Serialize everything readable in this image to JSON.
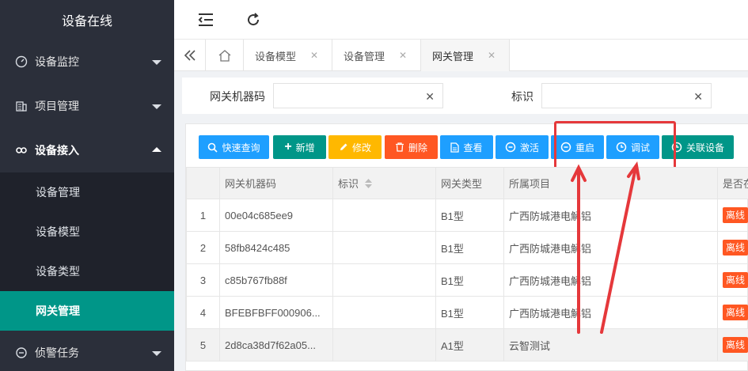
{
  "app": {
    "title": "设备在线"
  },
  "sidebar": {
    "items": [
      {
        "label": "设备监控",
        "icon": "gauge-icon"
      },
      {
        "label": "项目管理",
        "icon": "building-icon"
      },
      {
        "label": "设备接入",
        "icon": "link-icon"
      },
      {
        "label": "侦警任务",
        "icon": "task-icon"
      }
    ],
    "subitems": [
      {
        "label": "设备管理"
      },
      {
        "label": "设备模型"
      },
      {
        "label": "设备类型"
      },
      {
        "label": "网关管理"
      }
    ]
  },
  "tabs": [
    {
      "label": "设备模型"
    },
    {
      "label": "设备管理"
    },
    {
      "label": "网关管理"
    }
  ],
  "search": {
    "gateway_label": "网关机器码",
    "gateway_value": "",
    "ident_label": "标识",
    "ident_value": "",
    "clear": "✕"
  },
  "toolbar": {
    "query": "快速查询",
    "add": "新增",
    "edit": "修改",
    "delete": "删除",
    "view": "查看",
    "activate": "激活",
    "restart": "重启",
    "debug": "调试",
    "link": "关联设备"
  },
  "table": {
    "headers": [
      "网关机器码",
      "标识",
      "网关类型",
      "所属项目",
      "是否在"
    ],
    "rows": [
      {
        "num": "1",
        "code": "00e04c685ee9",
        "ident": "",
        "type": "B1型",
        "project": "广西防城港电解铝",
        "status": "离线"
      },
      {
        "num": "2",
        "code": "58fb8424c485",
        "ident": "",
        "type": "B1型",
        "project": "广西防城港电解铝",
        "status": "离线"
      },
      {
        "num": "3",
        "code": "c85b767fb88f",
        "ident": "",
        "type": "B1型",
        "project": "广西防城港电解铝",
        "status": "离线"
      },
      {
        "num": "4",
        "code": "BFEBFBFF000906...",
        "ident": "",
        "type": "B1型",
        "project": "广西防城港电解铝",
        "status": "离线"
      },
      {
        "num": "5",
        "code": "2d8ca38d7f62a05...",
        "ident": "",
        "type": "A1型",
        "project": "云智测试",
        "status": "离线"
      }
    ]
  },
  "colors": {
    "sidebar": "#2b2f3a",
    "active": "#009688",
    "primary": "#1e9fff",
    "danger": "#ff5722",
    "warn": "#ffb800",
    "annotation": "#e5383b"
  }
}
